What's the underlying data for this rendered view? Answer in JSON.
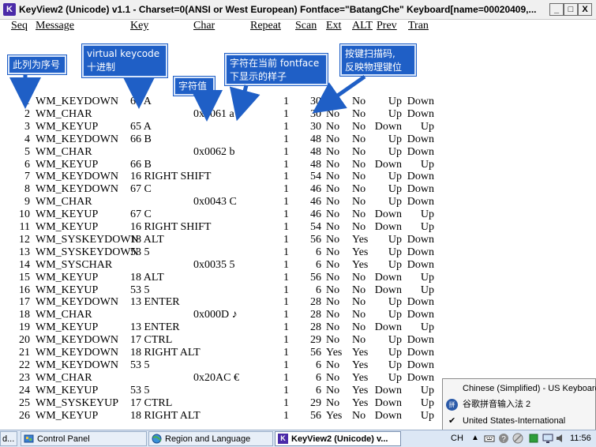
{
  "window": {
    "title": "KeyView2 (Unicode) v1.1 - Charset=0(ANSI or West European) Fontface=\"BatangChe\" Keyboard[name=00020409,...",
    "icon_letter": "K",
    "minimize": "_",
    "maximize": "□",
    "close": "X"
  },
  "columns": [
    "Seq",
    "Message",
    "Key",
    "Char",
    "Repeat",
    "Scan",
    "Ext",
    "ALT",
    "Prev",
    "Tran"
  ],
  "rows": [
    {
      "seq": "1",
      "msg": "WM_KEYDOWN",
      "key": "65 A",
      "char": "",
      "rep": "1",
      "scan": "30",
      "ext": "No",
      "alt": "No",
      "prev": "Up",
      "tran": "Down"
    },
    {
      "seq": "2",
      "msg": "WM_CHAR",
      "key": "",
      "char": "0x0061 a",
      "rep": "1",
      "scan": "30",
      "ext": "No",
      "alt": "No",
      "prev": "Up",
      "tran": "Down"
    },
    {
      "seq": "3",
      "msg": "WM_KEYUP",
      "key": "65 A",
      "char": "",
      "rep": "1",
      "scan": "30",
      "ext": "No",
      "alt": "No",
      "prev": "Down",
      "tran": "Up"
    },
    {
      "seq": "4",
      "msg": "WM_KEYDOWN",
      "key": "66 B",
      "char": "",
      "rep": "1",
      "scan": "48",
      "ext": "No",
      "alt": "No",
      "prev": "Up",
      "tran": "Down"
    },
    {
      "seq": "5",
      "msg": "WM_CHAR",
      "key": "",
      "char": "0x0062 b",
      "rep": "1",
      "scan": "48",
      "ext": "No",
      "alt": "No",
      "prev": "Up",
      "tran": "Down"
    },
    {
      "seq": "6",
      "msg": "WM_KEYUP",
      "key": "66 B",
      "char": "",
      "rep": "1",
      "scan": "48",
      "ext": "No",
      "alt": "No",
      "prev": "Down",
      "tran": "Up"
    },
    {
      "seq": "7",
      "msg": "WM_KEYDOWN",
      "key": "16 RIGHT SHIFT",
      "char": "",
      "rep": "1",
      "scan": "54",
      "ext": "No",
      "alt": "No",
      "prev": "Up",
      "tran": "Down"
    },
    {
      "seq": "8",
      "msg": "WM_KEYDOWN",
      "key": "67 C",
      "char": "",
      "rep": "1",
      "scan": "46",
      "ext": "No",
      "alt": "No",
      "prev": "Up",
      "tran": "Down"
    },
    {
      "seq": "9",
      "msg": "WM_CHAR",
      "key": "",
      "char": "0x0043 C",
      "rep": "1",
      "scan": "46",
      "ext": "No",
      "alt": "No",
      "prev": "Up",
      "tran": "Down"
    },
    {
      "seq": "10",
      "msg": "WM_KEYUP",
      "key": "67 C",
      "char": "",
      "rep": "1",
      "scan": "46",
      "ext": "No",
      "alt": "No",
      "prev": "Down",
      "tran": "Up"
    },
    {
      "seq": "11",
      "msg": "WM_KEYUP",
      "key": "16 RIGHT SHIFT",
      "char": "",
      "rep": "1",
      "scan": "54",
      "ext": "No",
      "alt": "No",
      "prev": "Down",
      "tran": "Up"
    },
    {
      "seq": "12",
      "msg": "WM_SYSKEYDOWN",
      "key": "18 ALT",
      "char": "",
      "rep": "1",
      "scan": "56",
      "ext": "No",
      "alt": "Yes",
      "prev": "Up",
      "tran": "Down"
    },
    {
      "seq": "13",
      "msg": "WM_SYSKEYDOWN",
      "key": "53 5",
      "char": "",
      "rep": "1",
      "scan": "6",
      "ext": "No",
      "alt": "Yes",
      "prev": "Up",
      "tran": "Down"
    },
    {
      "seq": "14",
      "msg": "WM_SYSCHAR",
      "key": "",
      "char": "0x0035 5",
      "rep": "1",
      "scan": "6",
      "ext": "No",
      "alt": "Yes",
      "prev": "Up",
      "tran": "Down"
    },
    {
      "seq": "15",
      "msg": "WM_KEYUP",
      "key": "18 ALT",
      "char": "",
      "rep": "1",
      "scan": "56",
      "ext": "No",
      "alt": "No",
      "prev": "Down",
      "tran": "Up"
    },
    {
      "seq": "16",
      "msg": "WM_KEYUP",
      "key": "53 5",
      "char": "",
      "rep": "1",
      "scan": "6",
      "ext": "No",
      "alt": "No",
      "prev": "Down",
      "tran": "Up"
    },
    {
      "seq": "17",
      "msg": "WM_KEYDOWN",
      "key": "13 ENTER",
      "char": "",
      "rep": "1",
      "scan": "28",
      "ext": "No",
      "alt": "No",
      "prev": "Up",
      "tran": "Down"
    },
    {
      "seq": "18",
      "msg": "WM_CHAR",
      "key": "",
      "char": "0x000D ♪",
      "rep": "1",
      "scan": "28",
      "ext": "No",
      "alt": "No",
      "prev": "Up",
      "tran": "Down"
    },
    {
      "seq": "19",
      "msg": "WM_KEYUP",
      "key": "13 ENTER",
      "char": "",
      "rep": "1",
      "scan": "28",
      "ext": "No",
      "alt": "No",
      "prev": "Down",
      "tran": "Up"
    },
    {
      "seq": "20",
      "msg": "WM_KEYDOWN",
      "key": "17 CTRL",
      "char": "",
      "rep": "1",
      "scan": "29",
      "ext": "No",
      "alt": "No",
      "prev": "Up",
      "tran": "Down"
    },
    {
      "seq": "21",
      "msg": "WM_KEYDOWN",
      "key": "18 RIGHT ALT",
      "char": "",
      "rep": "1",
      "scan": "56",
      "ext": "Yes",
      "alt": "Yes",
      "prev": "Up",
      "tran": "Down"
    },
    {
      "seq": "22",
      "msg": "WM_KEYDOWN",
      "key": "53 5",
      "char": "",
      "rep": "1",
      "scan": "6",
      "ext": "No",
      "alt": "Yes",
      "prev": "Up",
      "tran": "Down"
    },
    {
      "seq": "23",
      "msg": "WM_CHAR",
      "key": "",
      "char": "0x20AC €",
      "rep": "1",
      "scan": "6",
      "ext": "No",
      "alt": "Yes",
      "prev": "Up",
      "tran": "Down"
    },
    {
      "seq": "24",
      "msg": "WM_KEYUP",
      "key": "53 5",
      "char": "",
      "rep": "1",
      "scan": "6",
      "ext": "No",
      "alt": "Yes",
      "prev": "Down",
      "tran": "Up"
    },
    {
      "seq": "25",
      "msg": "WM_SYSKEYUP",
      "key": "17 CTRL",
      "char": "",
      "rep": "1",
      "scan": "29",
      "ext": "No",
      "alt": "Yes",
      "prev": "Down",
      "tran": "Up"
    },
    {
      "seq": "26",
      "msg": "WM_KEYUP",
      "key": "18 RIGHT ALT",
      "char": "",
      "rep": "1",
      "scan": "56",
      "ext": "Yes",
      "alt": "No",
      "prev": "Down",
      "tran": "Up"
    }
  ],
  "annotations": {
    "seq": "此列为序号",
    "vk_line1": "virtual  keycode",
    "vk_line2": "十进制",
    "char_value": "字符值",
    "font_line1": "字符在当前 fontface",
    "font_line2": "下显示的样子",
    "scan_line1": "按键扫描码,",
    "scan_line2": "反映物理键位",
    "color": "#1f5fc6"
  },
  "language_bar": {
    "items": [
      "Chinese (Simplified) - US Keyboard",
      "谷歌拼音输入法 2",
      "United States-International"
    ],
    "checked_index": 2
  },
  "taskbar": {
    "partial_left": "d...",
    "buttons": [
      "Control Panel",
      "Region and Language",
      "KeyView2 (Unicode) v..."
    ],
    "lang_indicator": "CH",
    "clock": "11:56"
  }
}
